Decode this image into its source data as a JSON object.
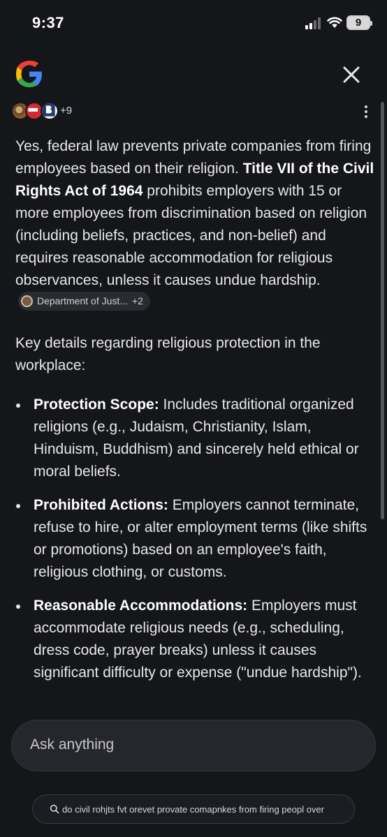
{
  "status_bar": {
    "time": "9:37",
    "battery": "9",
    "icons": [
      "signal-icon",
      "wifi-icon",
      "battery-icon"
    ]
  },
  "header": {
    "logo": "google-logo",
    "close_icon": "close-icon"
  },
  "sources": {
    "more_count": "+9",
    "menu_icon": "more-vertical-icon"
  },
  "answer": {
    "intro_plain": "Yes, federal law prevents private companies from firing employees based on their religion. ",
    "intro_bold": "Title VII of the Civil Rights Act of 1964",
    "intro_rest": " prohibits employers with 15 or more employees from discrimination based on religion (including beliefs, practices, and non-belief) and requires reasonable accommodation for religious observances, unless it causes undue hardship.",
    "citation": {
      "label": "Department of Just...",
      "count": "+2"
    },
    "key_details": "Key details regarding religious protection in the workplace:",
    "bullets": [
      {
        "title": "Protection Scope:",
        "text": " Includes traditional organized religions (e.g., Judaism, Christianity, Islam, Hinduism, Buddhism) and sincerely held ethical or moral beliefs."
      },
      {
        "title": "Prohibited Actions:",
        "text": " Employers cannot terminate, refuse to hire, or alter employment terms (like shifts or promotions) based on an employee's faith, religious clothing, or customs."
      },
      {
        "title": "Reasonable Accommodations:",
        "text": " Employers must accommodate religious needs (e.g., scheduling, dress code, prayer breaks) unless it causes significant difficulty or expense (\"undue hardship\")."
      }
    ]
  },
  "input": {
    "placeholder": "Ask anything"
  },
  "query": {
    "text": "do civil rohjts fvt orevet provate comapnkes from firing peopl over"
  },
  "colors": {
    "background": "#15161a",
    "text": "#e8e8ea",
    "chip": "#2a2b30",
    "input": "#26272c"
  }
}
